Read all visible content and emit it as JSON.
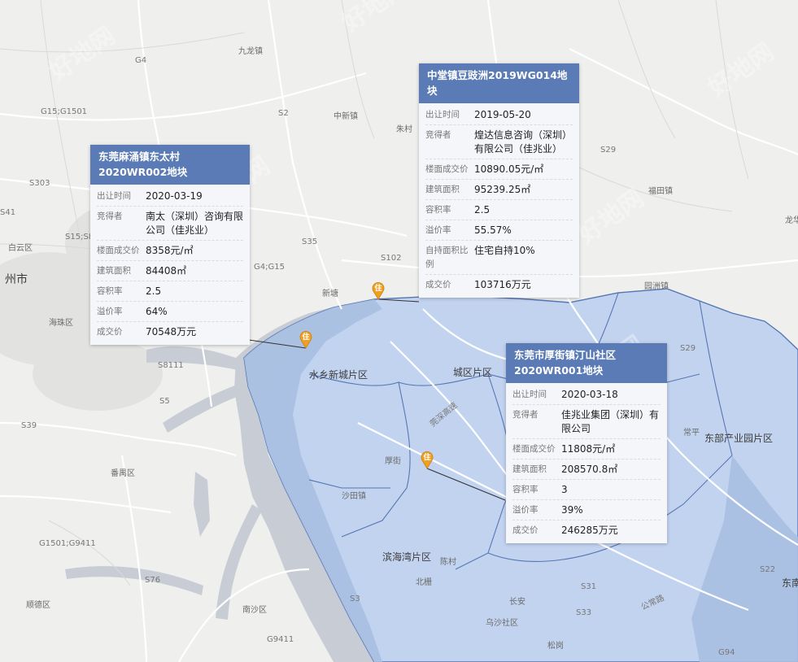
{
  "map": {
    "labels": {
      "jiulong": "九龙镇",
      "g4": "G4",
      "g15": "G15;G1501",
      "s2": "S2",
      "zhongxin": "中新镇",
      "zhucun": "朱村",
      "s303": "S303",
      "s41": "S41",
      "s15": "S15;S8",
      "baiyun": "白云区",
      "guangzhou": "州市",
      "haizhu": "海珠区",
      "s8111": "S8111",
      "s5": "S5",
      "s39": "S39",
      "panyu": "番禺区",
      "g1501": "G1501;G9411",
      "s76": "S76",
      "shunde": "顺德区",
      "nansha": "南沙区",
      "g9411": "G9411",
      "s35": "S35",
      "g4g15": "G4;G15",
      "s102": "S102",
      "xintang": "新塘",
      "s29": "S29",
      "fugang": "福田镇",
      "yuanzhou": "园洲镇",
      "longx": "龙华",
      "shuixiang": "水乡新城片区",
      "chengqu": "城区片区",
      "s29b": "S29",
      "dongbu": "东部产业园片区",
      "changping": "常平",
      "houjie": "厚街",
      "shatian": "沙田镇",
      "binhai": "滨海湾片区",
      "chencun": "陈村",
      "beizha": "北栅",
      "s3": "S3",
      "changan": "长安",
      "s31": "S31",
      "s33": "S33",
      "wusha": "乌沙社区",
      "songgang": "松岗",
      "s22": "S22",
      "dongnan": "东南",
      "g94": "G94",
      "jingguan": "莞深高速",
      "gongchang": "公常路"
    },
    "pin_label": "住",
    "watermark": "好地网",
    "colors": {
      "region_fill": "#bccfee",
      "region_stroke": "#5677b4",
      "water": "#c5cad3",
      "header": "#5a7bb5"
    }
  },
  "cards": [
    {
      "title": "东莞麻涌镇东太村2020WR002地块",
      "rows": [
        {
          "k": "出让时间",
          "v": "2020-03-19"
        },
        {
          "k": "竞得者",
          "v": "南太（深圳）咨询有限公司（佳兆业）"
        },
        {
          "k": "楼面成交价",
          "v": "8358元/㎡"
        },
        {
          "k": "建筑面积",
          "v": "84408㎡"
        },
        {
          "k": "容积率",
          "v": "2.5"
        },
        {
          "k": "溢价率",
          "v": "64%"
        },
        {
          "k": "成交价",
          "v": "70548万元"
        }
      ]
    },
    {
      "title": "中堂镇豆豉洲2019WG014地块",
      "rows": [
        {
          "k": "出让时间",
          "v": "2019-05-20"
        },
        {
          "k": "竞得者",
          "v": "煌达信息咨询（深圳）有限公司（佳兆业）"
        },
        {
          "k": "楼面成交价",
          "v": "10890.05元/㎡"
        },
        {
          "k": "建筑面积",
          "v": "95239.25㎡"
        },
        {
          "k": "容积率",
          "v": "2.5"
        },
        {
          "k": "溢价率",
          "v": "55.57%"
        },
        {
          "k": "自持面积比例",
          "v": "住宅自持10%"
        },
        {
          "k": "成交价",
          "v": "103716万元"
        }
      ]
    },
    {
      "title": "东莞市厚街镇汀山社区2020WR001地块",
      "rows": [
        {
          "k": "出让时间",
          "v": "2020-03-18"
        },
        {
          "k": "竞得者",
          "v": "佳兆业集团（深圳）有限公司"
        },
        {
          "k": "楼面成交价",
          "v": "11808元/㎡"
        },
        {
          "k": "建筑面积",
          "v": "208570.8㎡"
        },
        {
          "k": "容积率",
          "v": "3"
        },
        {
          "k": "溢价率",
          "v": "39%"
        },
        {
          "k": "成交价",
          "v": "246285万元"
        }
      ]
    }
  ]
}
